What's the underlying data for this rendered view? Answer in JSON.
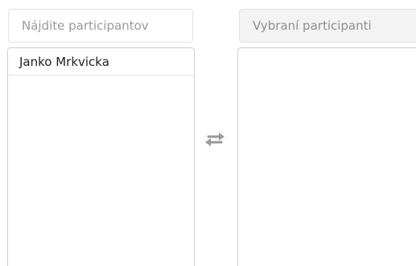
{
  "available": {
    "search_placeholder": "Nájdite participantov",
    "items": [
      {
        "label": "Janko Mrkvicka"
      }
    ]
  },
  "transfer": {
    "icon": "swap-arrows-icon"
  },
  "selected": {
    "header_label": "Vybraní participanti",
    "items": []
  }
}
